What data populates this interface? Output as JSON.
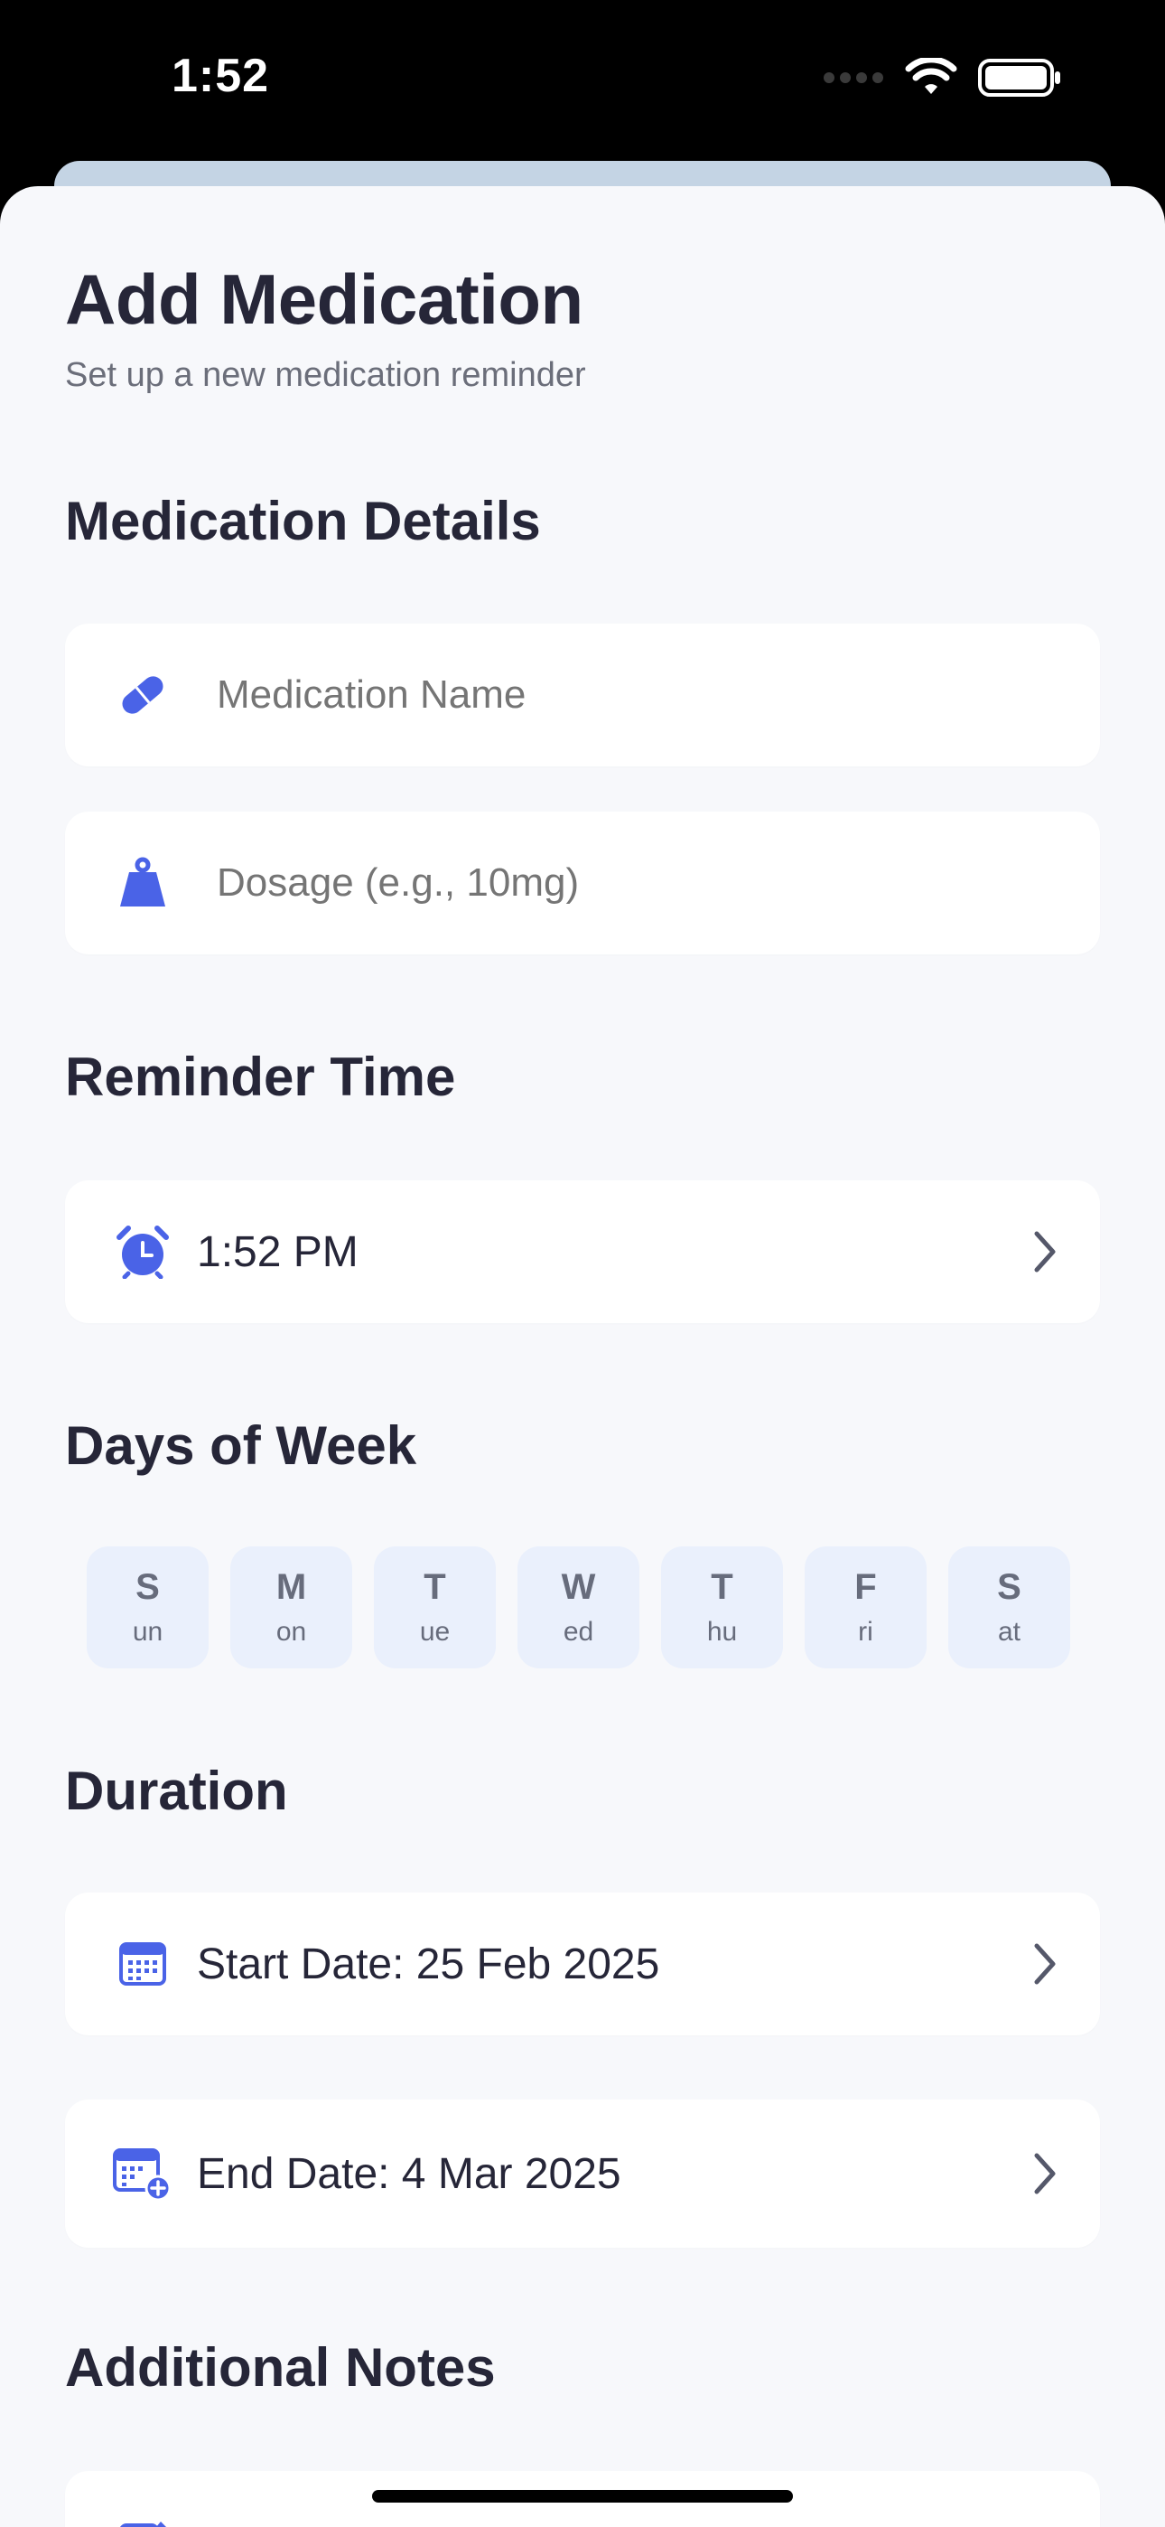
{
  "status_bar": {
    "time": "1:52"
  },
  "header": {
    "title": "Add Medication",
    "subtitle": "Set up a new medication reminder"
  },
  "sections": {
    "details": "Medication Details",
    "reminder": "Reminder Time",
    "days": "Days of Week",
    "duration": "Duration",
    "notes": "Additional Notes"
  },
  "fields": {
    "name_placeholder": "Medication Name",
    "dosage_placeholder": "Dosage (e.g., 10mg)",
    "reminder_time": "1:52 PM",
    "start_date": "Start Date: 25 Feb 2025",
    "end_date": "End Date: 4 Mar 2025"
  },
  "days": [
    {
      "letter": "S",
      "rest": "un"
    },
    {
      "letter": "M",
      "rest": "on"
    },
    {
      "letter": "T",
      "rest": "ue"
    },
    {
      "letter": "W",
      "rest": "ed"
    },
    {
      "letter": "T",
      "rest": "hu"
    },
    {
      "letter": "F",
      "rest": "ri"
    },
    {
      "letter": "S",
      "rest": "at"
    }
  ],
  "icons": {
    "name": "pill-icon",
    "dosage": "scale-icon",
    "reminder": "alarm-clock-icon",
    "start": "calendar-icon",
    "end": "calendar-add-icon",
    "notes": "notes-icon",
    "chevron": "chevron-right-icon"
  },
  "colors": {
    "accent": "#4a63e7",
    "background": "#f7f8fb",
    "text": "#262638",
    "day_chip": "#eaf0fc"
  }
}
